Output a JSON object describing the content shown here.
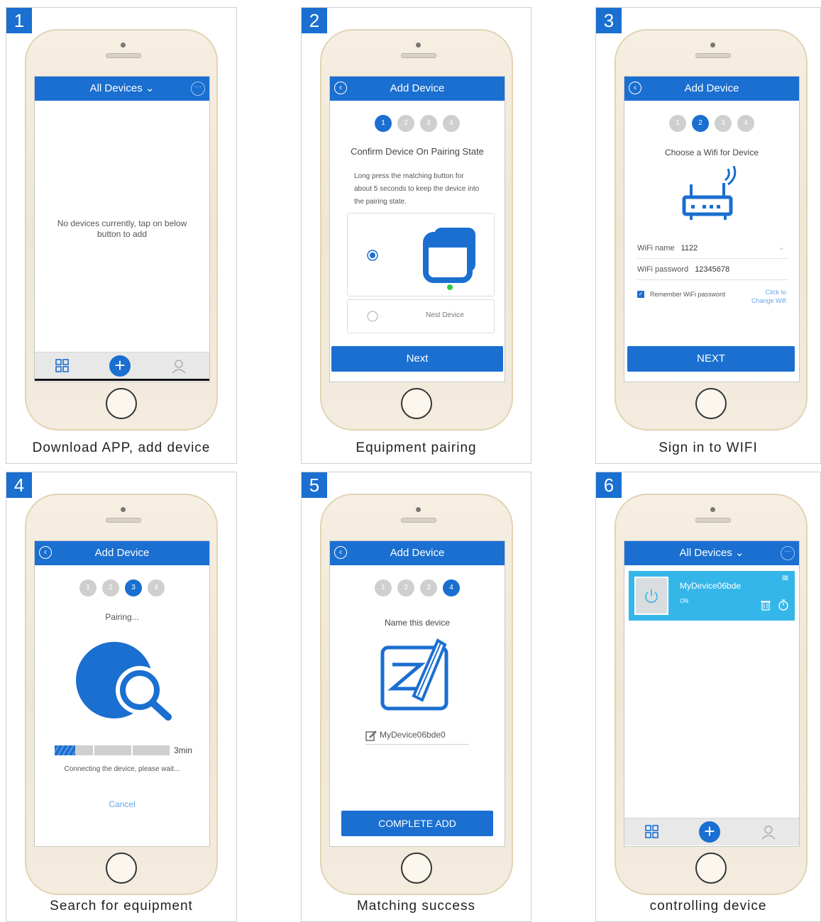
{
  "panels": [
    {
      "badge": "1",
      "caption": "Download APP, add device"
    },
    {
      "badge": "2",
      "caption": "Equipment pairing"
    },
    {
      "badge": "3",
      "caption": "Sign in to WIFI"
    },
    {
      "badge": "4",
      "caption": "Search for equipment"
    },
    {
      "badge": "5",
      "caption": "Matching success"
    },
    {
      "badge": "6",
      "caption": "controlling device"
    }
  ],
  "screen1": {
    "title": "All Devices",
    "empty_message": "No devices currently, tap on below button to add"
  },
  "screen2": {
    "title": "Add Device",
    "steps": [
      "1",
      "2",
      "3",
      "4"
    ],
    "heading": "Confirm Device On Pairing State",
    "instructions": "Long press the matching button for about 5 seconds to keep the device into the pairing state.",
    "option_nest": "Nest Device",
    "next_label": "Next"
  },
  "screen3": {
    "title": "Add Device",
    "steps": [
      "1",
      "2",
      "3",
      "4"
    ],
    "heading": "Choose a Wifi for Device",
    "wifi_name_label": "WiFi name",
    "wifi_name_value": "1122",
    "wifi_password_label": "WiFi password",
    "wifi_password_value": "12345678",
    "remember_label": "Remember WiFi password",
    "change_wifi_line1": "Click to",
    "change_wifi_line2": "Change Wifi",
    "next_label": "NEXT"
  },
  "screen4": {
    "title": "Add Device",
    "steps": [
      "1",
      "2",
      "3",
      "4"
    ],
    "heading": "Pairing...",
    "timer": "3min",
    "progress_fraction": 0.18,
    "status": "Connecting the device, please wait...",
    "cancel_label": "Cancel"
  },
  "screen5": {
    "title": "Add Device",
    "steps": [
      "1",
      "2",
      "3",
      "4"
    ],
    "heading": "Name this device",
    "device_name": "MyDevice06bde0",
    "complete_label": "COMPLETE ADD"
  },
  "screen6": {
    "title": "All Devices",
    "device_name": "MyDevice06bde",
    "device_status": "ON"
  },
  "colors": {
    "accent": "#1a6fd0",
    "device_card": "#35b6e9",
    "status_green": "#2ecc40"
  }
}
